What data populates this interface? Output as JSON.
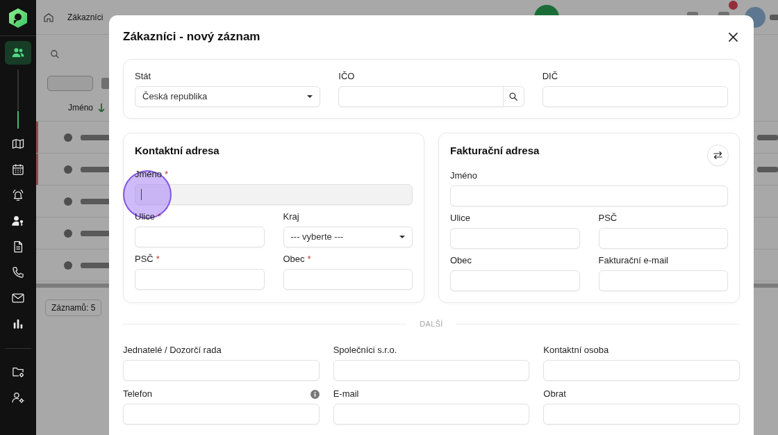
{
  "sidebar": {
    "items": [
      {
        "selected": true
      },
      {
        "selected": false
      },
      {
        "selected": false
      },
      {
        "selected": false
      },
      {
        "selected": false
      },
      {
        "selected": false
      },
      {
        "selected": false
      },
      {
        "selected": false
      },
      {
        "selected": false
      }
    ],
    "bottom_items": [
      {
        "selected": false
      },
      {
        "selected": false
      }
    ]
  },
  "background": {
    "breadcrumb": "Zákazníci",
    "column_header": "Jméno",
    "record_count": "Záznamů: 5"
  },
  "dialog": {
    "title": "Zákazníci - nový záznam",
    "required_marker": "*",
    "identity_fields": [
      {
        "label": "Stát",
        "kind": "select",
        "value": "Česká republika",
        "required": false,
        "focused": false
      },
      {
        "label": "IČO",
        "kind": "search",
        "required": false,
        "focused": false
      },
      {
        "label": "DIČ",
        "kind": "text",
        "required": false,
        "focused": false
      }
    ],
    "contact_address": {
      "title": "Kontaktní adresa",
      "rows": [
        [
          {
            "label": "Jméno",
            "kind": "text",
            "required": true,
            "focused": true
          }
        ],
        [
          {
            "label": "Ulice",
            "kind": "text",
            "required": true,
            "focused": false
          },
          {
            "label": "Kraj",
            "kind": "select",
            "value": "--- vyberte ---",
            "required": false,
            "focused": false
          }
        ],
        [
          {
            "label": "PSČ",
            "kind": "text",
            "required": true,
            "focused": false
          },
          {
            "label": "Obec",
            "kind": "text",
            "required": true,
            "focused": false
          }
        ]
      ]
    },
    "billing_address": {
      "title": "Fakturační adresa",
      "rows": [
        [
          {
            "label": "Jméno",
            "kind": "text",
            "required": false,
            "focused": false
          }
        ],
        [
          {
            "label": "Ulice",
            "kind": "text",
            "required": false,
            "focused": false
          },
          {
            "label": "PSČ",
            "kind": "text",
            "required": false,
            "focused": false
          }
        ],
        [
          {
            "label": "Obec",
            "kind": "text",
            "required": false,
            "focused": false
          },
          {
            "label": "Fakturační e-mail",
            "kind": "text",
            "required": false,
            "focused": false
          }
        ]
      ]
    },
    "section_label": "DALŠÍ",
    "other_fields": [
      [
        {
          "label": "Jednatelé / Dozorčí rada",
          "kind": "text",
          "required": false,
          "focused": false,
          "info": false
        },
        {
          "label": "Společníci s.r.o.",
          "kind": "text",
          "required": false,
          "focused": false,
          "info": false
        },
        {
          "label": "Kontaktní osoba",
          "kind": "text",
          "required": false,
          "focused": false,
          "info": false
        }
      ],
      [
        {
          "label": "Telefon",
          "kind": "text",
          "required": false,
          "focused": false,
          "info": true
        },
        {
          "label": "E-mail",
          "kind": "text",
          "required": false,
          "focused": false,
          "info": false
        },
        {
          "label": "Obrat",
          "kind": "text",
          "required": false,
          "focused": false,
          "info": false
        }
      ]
    ]
  }
}
